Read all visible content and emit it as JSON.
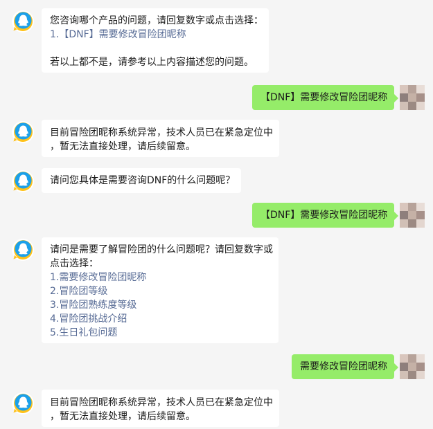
{
  "messages": {
    "m1": {
      "l1": "您咨询哪个产品的问题，请回复数字或点击选择：",
      "l2": "1.【DNF】需要修改冒险团昵称",
      "l3": "若以上都不是，请参考以上内容描述您的问题。"
    },
    "m2": {
      "text": "【DNF】需要修改冒险团昵称"
    },
    "m3": {
      "l1": "目前冒险团昵称系统异常，技术人员已在紧急定位中",
      "l2": "，暂无法直接处理，请后续留意。"
    },
    "m4": {
      "text": "请问您具体是需要咨询DNF的什么问题呢？"
    },
    "m5": {
      "text": "【DNF】需要修改冒险团昵称"
    },
    "m6": {
      "l1": "请问是需要了解冒险团的什么问题呢？请回复数字或",
      "l2": "点击选择：",
      "options": [
        "1.需要修改冒险团昵称",
        "2.冒险团等级",
        "3.冒险团熟练度等级",
        "4.冒险团挑战介绍",
        "5.生日礼包问题"
      ]
    },
    "m7": {
      "text": "需要修改冒险团昵称"
    },
    "m8": {
      "l1": "目前冒险团昵称系统异常，技术人员已在紧急定位中",
      "l2": "，暂无法直接处理，请后续留意。"
    }
  },
  "colors": {
    "background": "#f5f5f5",
    "incoming_bubble": "#ffffff",
    "outgoing_bubble": "#95ec69",
    "link": "#576b95",
    "logo_blue": "#1ba0ea",
    "logo_yellow": "#ffc21a"
  },
  "icons": {
    "service_avatar": "qq-penguin-logo-icon",
    "user_avatar": "blurred-user-avatar"
  }
}
